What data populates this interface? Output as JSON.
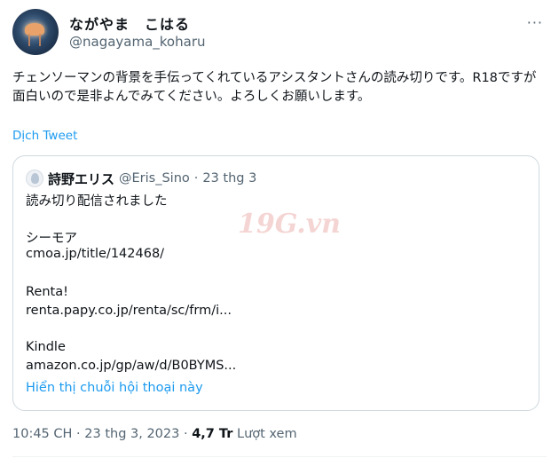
{
  "author": {
    "display_name": "ながやま　こはる",
    "handle": "@nagayama_koharu",
    "more_label": "···"
  },
  "tweet": {
    "text": "チェンソーマンの背景を手伝ってくれているアシスタントさんの読み切りです。R18ですが面白いので是非よんでみてください。よろしくお願いします。",
    "translate_label": "Dịch Tweet"
  },
  "quote": {
    "display_name": "詩野エリス",
    "handle": "@Eris_Sino",
    "separator": "·",
    "date": "23 thg 3",
    "lines": [
      "読み切り配信されました",
      "シーモア",
      "cmoa.jp/title/142468/",
      "Renta!",
      "renta.papy.co.jp/renta/sc/frm/i...",
      "Kindle",
      "amazon.co.jp/gp/aw/d/B0BYMS..."
    ],
    "show_thread_label": "Hiển thị chuỗi hội thoại này"
  },
  "watermark_text": "19G.vn",
  "meta": {
    "time": "10:45 CH",
    "separator": "·",
    "date": "23 thg 3, 2023",
    "views": "4,7 Tr",
    "views_label": "Lượt xem"
  }
}
